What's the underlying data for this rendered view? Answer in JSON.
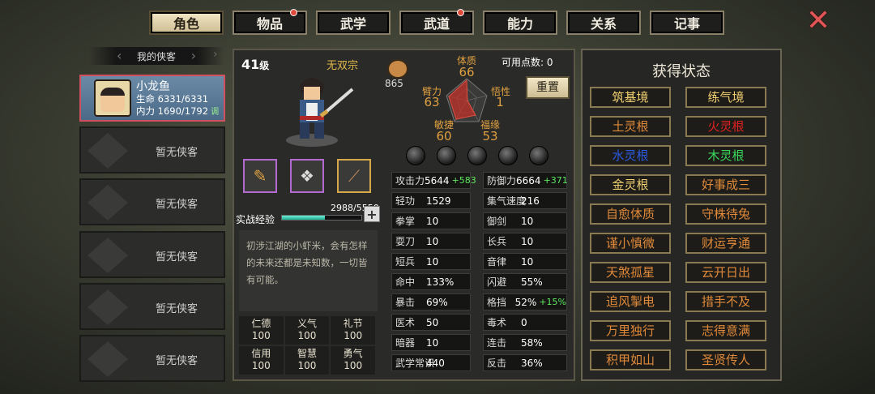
{
  "tabs": [
    {
      "label": "角色",
      "active": true,
      "notice": false
    },
    {
      "label": "物品",
      "active": false,
      "notice": true
    },
    {
      "label": "武学",
      "active": false,
      "notice": false
    },
    {
      "label": "武道",
      "active": false,
      "notice": true
    },
    {
      "label": "能力",
      "active": false,
      "notice": false
    },
    {
      "label": "关系",
      "active": false,
      "notice": false
    },
    {
      "label": "记事",
      "active": false,
      "notice": false
    }
  ],
  "party": {
    "header": "我的侠客",
    "selected": {
      "name": "小龙鱼",
      "hp_label": "生命",
      "hp": "6331/6331",
      "mp_label": "内力",
      "mp": "1690/1792",
      "adjust": "调"
    },
    "empty_label": "暂无侠客"
  },
  "character": {
    "level": "41",
    "level_unit": "级",
    "sect": "无双宗",
    "prestige": "865",
    "attribute_points_label": "可用点数:",
    "attribute_points": "0",
    "reset_label": "重置",
    "radar": {
      "tizhi": {
        "label": "体质",
        "value": "66"
      },
      "wuxing": {
        "label": "悟性",
        "value": "1"
      },
      "fuyuan": {
        "label": "福缘",
        "value": "53"
      },
      "minjie": {
        "label": "敏捷",
        "value": "60"
      },
      "bili": {
        "label": "臂力",
        "value": "63"
      }
    },
    "exp_label": "实战经验",
    "exp_text": "2988/5550",
    "exp_fraction": 0.538,
    "bio": "初涉江湖的小虾米，会有怎样的未来还都是未知数，一切皆有可能。",
    "virtues": [
      {
        "name": "仁德",
        "value": "100"
      },
      {
        "name": "义气",
        "value": "100"
      },
      {
        "name": "礼节",
        "value": "100"
      },
      {
        "name": "信用",
        "value": "100"
      },
      {
        "name": "智慧",
        "value": "100"
      },
      {
        "name": "勇气",
        "value": "100"
      }
    ]
  },
  "stats_left": [
    {
      "name": "攻击力",
      "value": "5644",
      "bonus": "+583"
    },
    {
      "name": "轻功",
      "value": "1529",
      "bonus": ""
    },
    {
      "name": "拳掌",
      "value": "10",
      "bonus": ""
    },
    {
      "name": "耍刀",
      "value": "10",
      "bonus": ""
    },
    {
      "name": "短兵",
      "value": "10",
      "bonus": ""
    },
    {
      "name": "命中",
      "value": "133%",
      "bonus": ""
    },
    {
      "name": "暴击",
      "value": "69%",
      "bonus": ""
    },
    {
      "name": "医术",
      "value": "50",
      "bonus": ""
    },
    {
      "name": "暗器",
      "value": "10",
      "bonus": ""
    },
    {
      "name": "武学常识",
      "value": "440",
      "bonus": ""
    }
  ],
  "stats_right": [
    {
      "name": "防御力",
      "value": "6664",
      "bonus": "+371"
    },
    {
      "name": "集气速度",
      "value": "216",
      "bonus": ""
    },
    {
      "name": "御剑",
      "value": "10",
      "bonus": ""
    },
    {
      "name": "长兵",
      "value": "10",
      "bonus": ""
    },
    {
      "name": "音律",
      "value": "10",
      "bonus": ""
    },
    {
      "name": "闪避",
      "value": "55%",
      "bonus": ""
    },
    {
      "name": "格挡",
      "value": "52%",
      "bonus": "+15%"
    },
    {
      "name": "毒术",
      "value": "0",
      "bonus": ""
    },
    {
      "name": "连击",
      "value": "58%",
      "bonus": ""
    },
    {
      "name": "反击",
      "value": "36%",
      "bonus": ""
    }
  ],
  "status": {
    "title": "获得状态",
    "items": [
      {
        "label": "筑基境",
        "color": "#f0d070"
      },
      {
        "label": "练气境",
        "color": "#f0d070"
      },
      {
        "label": "土灵根",
        "color": "#e08a3a"
      },
      {
        "label": "火灵根",
        "color": "#e02020"
      },
      {
        "label": "水灵根",
        "color": "#2a5ae0"
      },
      {
        "label": "木灵根",
        "color": "#3ad85a"
      },
      {
        "label": "金灵根",
        "color": "#f0d070"
      },
      {
        "label": "好事成三",
        "color": "#e08a3a"
      },
      {
        "label": "自愈体质",
        "color": "#e08a3a"
      },
      {
        "label": "守株待兔",
        "color": "#e08a3a"
      },
      {
        "label": "谨小慎微",
        "color": "#e08a3a"
      },
      {
        "label": "财运亨通",
        "color": "#e08a3a"
      },
      {
        "label": "天煞孤星",
        "color": "#e08a3a"
      },
      {
        "label": "云开日出",
        "color": "#e08a3a"
      },
      {
        "label": "追风掣电",
        "color": "#e08a3a"
      },
      {
        "label": "措手不及",
        "color": "#e08a3a"
      },
      {
        "label": "万里独行",
        "color": "#e08a3a"
      },
      {
        "label": "志得意满",
        "color": "#e08a3a"
      },
      {
        "label": "积甲如山",
        "color": "#e08a3a"
      },
      {
        "label": "圣贤传人",
        "color": "#e08a3a"
      }
    ]
  }
}
